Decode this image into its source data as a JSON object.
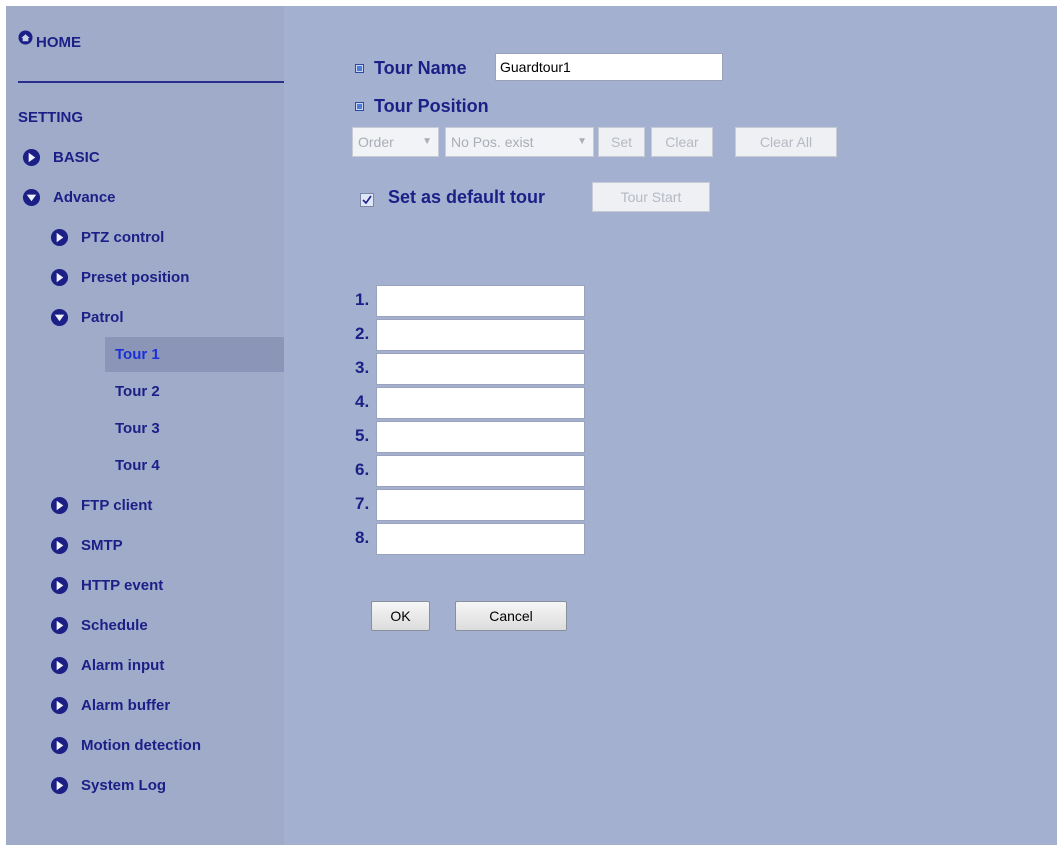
{
  "sidebar": {
    "home_label": "HOME",
    "setting_label": "SETTING",
    "basic_label": "BASIC",
    "advance_label": "Advance",
    "advance_items": {
      "ptz": "PTZ control",
      "preset": "Preset position",
      "patrol": "Patrol"
    },
    "patrol_tours": [
      "Tour 1",
      "Tour 2",
      "Tour 3",
      "Tour 4"
    ],
    "active_tour": "Tour 1",
    "more_items": [
      "FTP client",
      "SMTP",
      "HTTP event",
      "Schedule",
      "Alarm input",
      "Alarm buffer",
      "Motion detection",
      "System Log"
    ]
  },
  "form": {
    "tour_name_label": "Tour Name",
    "tour_name_value": "Guardtour1",
    "tour_position_label": "Tour Position",
    "order_select": "Order",
    "position_select": "No Pos. exist",
    "set_button": "Set",
    "clear_button": "Clear",
    "clear_all_button": "Clear All",
    "default_tour_checked": true,
    "default_tour_label": "Set as default tour",
    "tour_start_button": "Tour Start",
    "positions": [
      {
        "label": "1.",
        "value": ""
      },
      {
        "label": "2.",
        "value": ""
      },
      {
        "label": "3.",
        "value": ""
      },
      {
        "label": "4.",
        "value": ""
      },
      {
        "label": "5.",
        "value": ""
      },
      {
        "label": "6.",
        "value": ""
      },
      {
        "label": "7.",
        "value": ""
      },
      {
        "label": "8.",
        "value": ""
      }
    ],
    "ok_button": "OK",
    "cancel_button": "Cancel"
  },
  "colors": {
    "background": "#a4b0cf",
    "sidebar": "#a0abca",
    "text": "#1b1f86",
    "active_item": "#8a95b7",
    "active_text": "#1a30d8"
  }
}
